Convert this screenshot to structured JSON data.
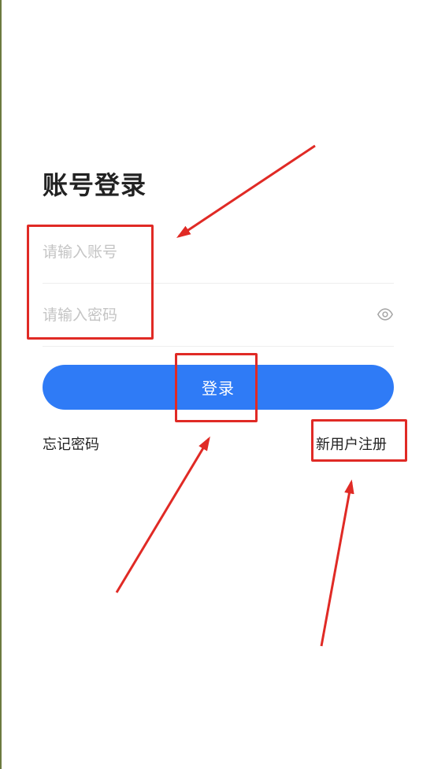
{
  "page": {
    "title": "账号登录"
  },
  "form": {
    "account_placeholder": "请输入账号",
    "account_value": "",
    "password_placeholder": "请输入密码",
    "password_value": "",
    "password_toggle_icon": "eye-icon"
  },
  "actions": {
    "login_label": "登录",
    "forgot_password_label": "忘记密码",
    "register_label": "新用户注册"
  },
  "colors": {
    "primary_button": "#2f7bf6",
    "annotation_red": "#e02a25",
    "title_text": "#222222",
    "placeholder_text": "#c4c4c4"
  }
}
